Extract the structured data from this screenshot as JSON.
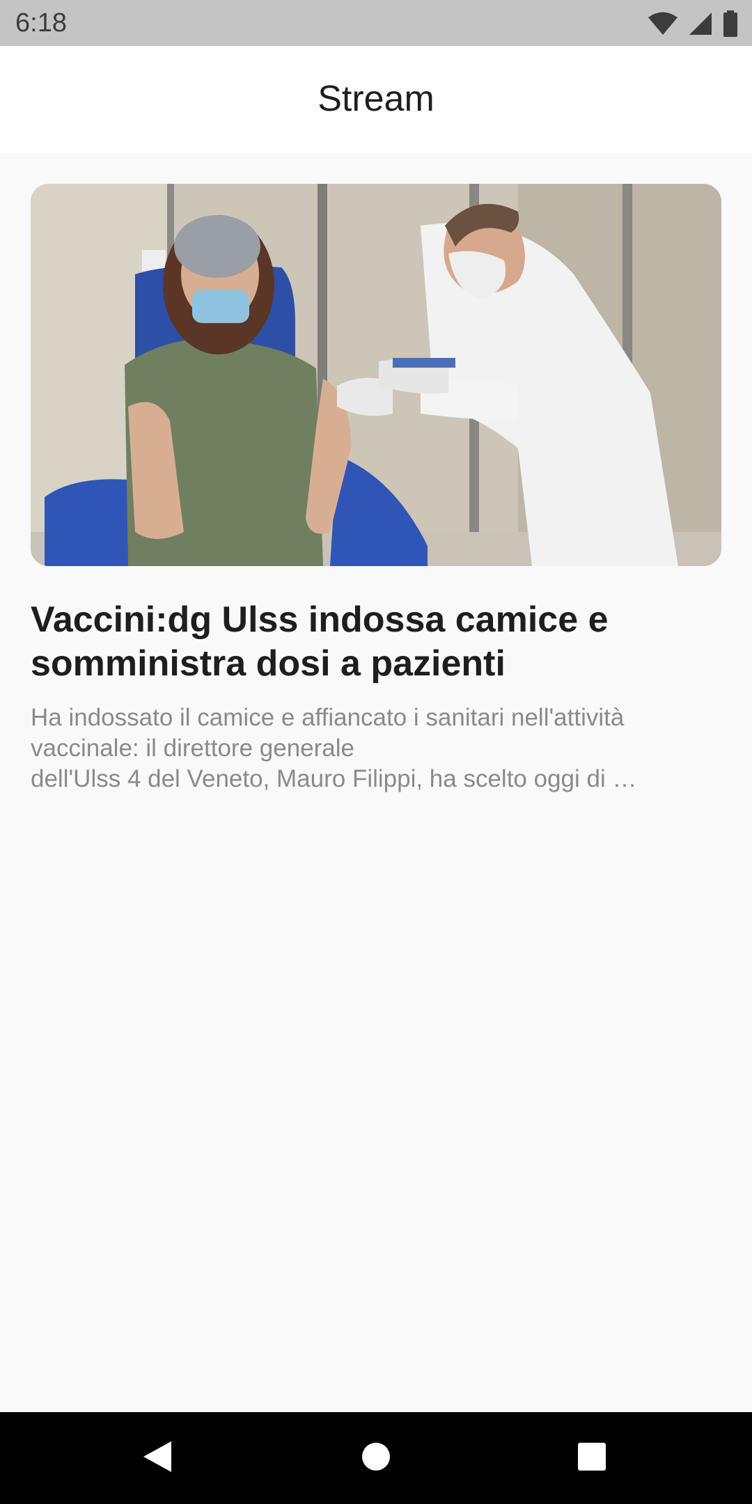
{
  "status_bar": {
    "time": "6:18",
    "icons": [
      "wifi-icon",
      "cellular-signal-icon",
      "battery-icon"
    ]
  },
  "app_bar": {
    "title": "Stream"
  },
  "article": {
    "image_alt": "Doctor in white coat administering a vaccine to a seated masked woman",
    "title": "Vaccini:dg Ulss indossa camice e somministra dosi a pazienti",
    "excerpt": "Ha indossato il camice e affiancato i sanitari nell'attività vaccinale: il direttore generale\ndell'Ulss 4 del Veneto, Mauro Filippi, ha scelto oggi di …"
  },
  "nav_bar": {
    "icons": [
      "back-icon",
      "home-icon",
      "recents-icon"
    ]
  },
  "colors": {
    "status_bar": "#c4c4c4",
    "app_bar": "#ffffff",
    "background": "#f9f9f9",
    "title_text": "#1e1e1e",
    "excerpt_text": "#8a8a8a",
    "nav_bar": "#000000"
  }
}
